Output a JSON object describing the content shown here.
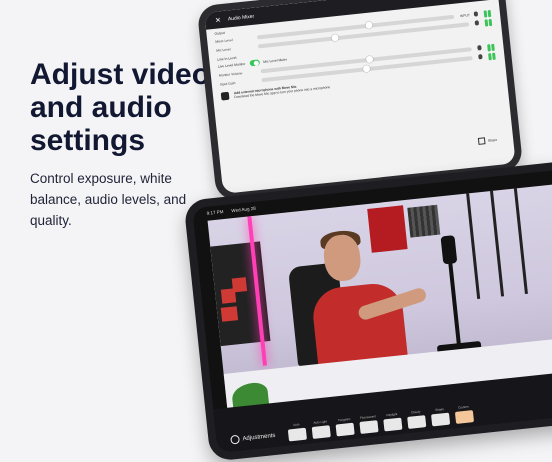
{
  "marketing": {
    "headline": "Adjust video and audio settings",
    "subline": "Control exposure, white balance, audio levels, and quality."
  },
  "audio_panel": {
    "title": "Audio Mixer",
    "output_label": "Output",
    "channel_label": "INPUT",
    "rows": [
      {
        "label": "Mixer Level",
        "level": 0.55
      },
      {
        "label": "Mic Level",
        "level": 0.35
      },
      {
        "label": "Live Level Monitor",
        "level": 0.42
      },
      {
        "label": "Monitor Volume",
        "level": 0.5
      },
      {
        "label": "Input Gain",
        "level": 0.48
      }
    ],
    "section_label": "Line In Level",
    "toggle_label": "Mic Level Meter",
    "toggle_on": true,
    "note_title": "Add external microphone with Move Mic",
    "note_body": "Download the Move Mic app to turn your phone into a microphone",
    "share_label": "Share",
    "meter_color": "#3cc45b"
  },
  "video_panel": {
    "status_time": "9:17 PM",
    "status_date": "Wed Aug 28",
    "adjustments_label": "Adjustments",
    "presets": [
      "Auto",
      "Auto Light",
      "Tungsten",
      "Fluorescent",
      "Daylight",
      "Cloudy",
      "Shade",
      "Custom"
    ],
    "active_preset_index": 7,
    "accent_color": "#f4c79a"
  }
}
